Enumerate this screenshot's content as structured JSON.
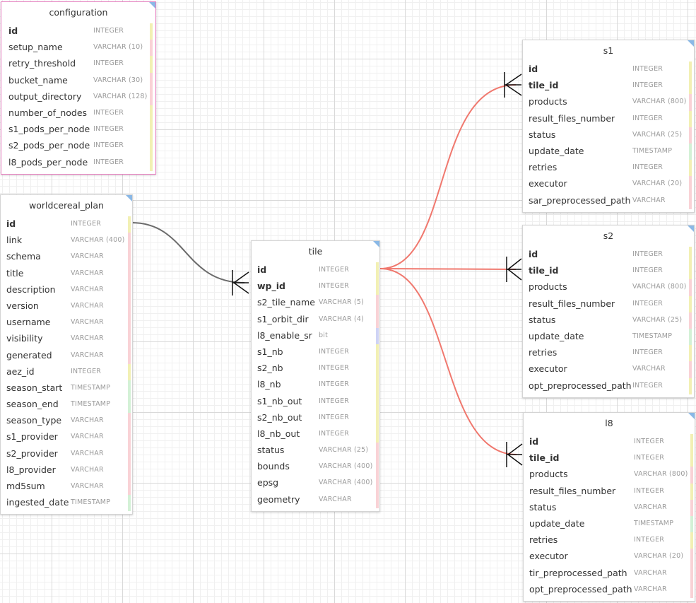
{
  "type_colors": {
    "INTEGER": "#f2f0b4",
    "VARCHAR": "#f9d2d6",
    "TIMESTAMP": "#d3f1d6",
    "bit": "#cfd3f5"
  },
  "link_colors": {
    "gray": "#6b6b6b",
    "red": "#f0786e"
  },
  "tables": [
    {
      "key": "configuration",
      "title": "configuration",
      "border": "#e77fc0",
      "cols": [
        {
          "name": "id",
          "type": "INTEGER",
          "pk": true
        },
        {
          "name": "setup_name",
          "type": "VARCHAR (10)"
        },
        {
          "name": "retry_threshold",
          "type": "INTEGER"
        },
        {
          "name": "bucket_name",
          "type": "VARCHAR (30)"
        },
        {
          "name": "output_directory",
          "type": "VARCHAR (128)"
        },
        {
          "name": "number_of_nodes",
          "type": "INTEGER"
        },
        {
          "name": "s1_pods_per_node",
          "type": "INTEGER"
        },
        {
          "name": "s2_pods_per_node",
          "type": "INTEGER"
        },
        {
          "name": "l8_pods_per_node",
          "type": "INTEGER"
        }
      ]
    },
    {
      "key": "worldcereal_plan",
      "title": "worldcereal_plan",
      "cols": [
        {
          "name": "id",
          "type": "INTEGER",
          "pk": true
        },
        {
          "name": "link",
          "type": "VARCHAR (400)"
        },
        {
          "name": "schema",
          "type": "VARCHAR"
        },
        {
          "name": "title",
          "type": "VARCHAR"
        },
        {
          "name": "description",
          "type": "VARCHAR"
        },
        {
          "name": "version",
          "type": "VARCHAR"
        },
        {
          "name": "username",
          "type": "VARCHAR"
        },
        {
          "name": "visibility",
          "type": "VARCHAR"
        },
        {
          "name": "generated",
          "type": "VARCHAR"
        },
        {
          "name": "aez_id",
          "type": "INTEGER"
        },
        {
          "name": "season_start",
          "type": "TIMESTAMP"
        },
        {
          "name": "season_end",
          "type": "TIMESTAMP"
        },
        {
          "name": "season_type",
          "type": "VARCHAR"
        },
        {
          "name": "s1_provider",
          "type": "VARCHAR"
        },
        {
          "name": "s2_provider",
          "type": "VARCHAR"
        },
        {
          "name": "l8_provider",
          "type": "VARCHAR"
        },
        {
          "name": "md5sum",
          "type": "VARCHAR"
        },
        {
          "name": "ingested_date",
          "type": "TIMESTAMP"
        }
      ]
    },
    {
      "key": "tile",
      "title": "tile",
      "cols": [
        {
          "name": "id",
          "type": "INTEGER",
          "pk": true
        },
        {
          "name": "wp_id",
          "type": "INTEGER",
          "pk": true
        },
        {
          "name": "s2_tile_name",
          "type": "VARCHAR (5)"
        },
        {
          "name": "s1_orbit_dir",
          "type": "VARCHAR (4)"
        },
        {
          "name": "l8_enable_sr",
          "type": "bit"
        },
        {
          "name": "s1_nb",
          "type": "INTEGER"
        },
        {
          "name": "s2_nb",
          "type": "INTEGER"
        },
        {
          "name": "l8_nb",
          "type": "INTEGER"
        },
        {
          "name": "s1_nb_out",
          "type": "INTEGER"
        },
        {
          "name": "s2_nb_out",
          "type": "INTEGER"
        },
        {
          "name": "l8_nb_out",
          "type": "INTEGER"
        },
        {
          "name": "status",
          "type": "VARCHAR (25)"
        },
        {
          "name": "bounds",
          "type": "VARCHAR (400)"
        },
        {
          "name": "epsg",
          "type": "VARCHAR (400)"
        },
        {
          "name": "geometry",
          "type": "VARCHAR"
        }
      ]
    },
    {
      "key": "s1",
      "title": "s1",
      "cols": [
        {
          "name": "id",
          "type": "INTEGER",
          "pk": true
        },
        {
          "name": "tile_id",
          "type": "INTEGER",
          "pk": true
        },
        {
          "name": "products",
          "type": "VARCHAR (800)"
        },
        {
          "name": "result_files_number",
          "type": "INTEGER"
        },
        {
          "name": "status",
          "type": "VARCHAR (25)"
        },
        {
          "name": "update_date",
          "type": "TIMESTAMP"
        },
        {
          "name": "retries",
          "type": "INTEGER"
        },
        {
          "name": "executor",
          "type": "VARCHAR (20)"
        },
        {
          "name": "sar_preprocessed_path",
          "type": "VARCHAR"
        }
      ]
    },
    {
      "key": "s2",
      "title": "s2",
      "cols": [
        {
          "name": "id",
          "type": "INTEGER",
          "pk": true
        },
        {
          "name": "tile_id",
          "type": "INTEGER",
          "pk": true
        },
        {
          "name": "products",
          "type": "VARCHAR (800)"
        },
        {
          "name": "result_files_number",
          "type": "INTEGER"
        },
        {
          "name": "status",
          "type": "VARCHAR (25)"
        },
        {
          "name": "update_date",
          "type": "TIMESTAMP"
        },
        {
          "name": "retries",
          "type": "INTEGER"
        },
        {
          "name": "executor",
          "type": "VARCHAR"
        },
        {
          "name": "opt_preprocessed_path",
          "type": "INTEGER"
        }
      ]
    },
    {
      "key": "l8",
      "title": "l8",
      "cols": [
        {
          "name": "id",
          "type": "INTEGER",
          "pk": true
        },
        {
          "name": "tile_id",
          "type": "INTEGER",
          "pk": true
        },
        {
          "name": "products",
          "type": "VARCHAR (800)"
        },
        {
          "name": "result_files_number",
          "type": "INTEGER"
        },
        {
          "name": "status",
          "type": "VARCHAR"
        },
        {
          "name": "update_date",
          "type": "TIMESTAMP"
        },
        {
          "name": "retries",
          "type": "INTEGER"
        },
        {
          "name": "executor",
          "type": "VARCHAR (20)"
        },
        {
          "name": "tir_preprocessed_path",
          "type": "VARCHAR"
        },
        {
          "name": "opt_preprocessed_path",
          "type": "VARCHAR"
        }
      ]
    }
  ],
  "relations": [
    {
      "from": "worldcereal_plan.id",
      "to": "tile.wp_id",
      "color": "gray"
    },
    {
      "from": "tile.id",
      "to": "s1.tile_id",
      "color": "red"
    },
    {
      "from": "tile.id",
      "to": "s2.tile_id",
      "color": "red"
    },
    {
      "from": "tile.id",
      "to": "l8.tile_id",
      "color": "red"
    }
  ]
}
